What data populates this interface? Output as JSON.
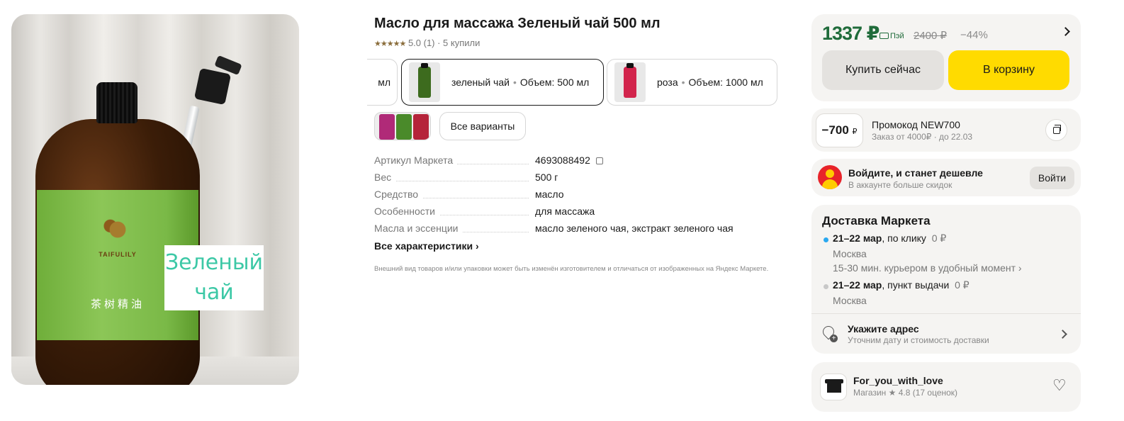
{
  "gallery": {
    "caption": "Зеленый чай",
    "bottle_brand": "TAIFULILY",
    "bottle_label_cn": "茶树精油"
  },
  "product": {
    "title": "Масло для массажа Зеленый чай 500 мл",
    "stars": "★★★★★",
    "rating_text": "5.0 (1) · 5 купили"
  },
  "variants": [
    {
      "label": "мл",
      "color": "#5a7d2c"
    },
    {
      "name": "зеленый чай",
      "volume": "Объем: 500 мл",
      "separator": "•",
      "color": "#3d6b1e"
    },
    {
      "name": "роза",
      "volume": "Объем: 1000 мл",
      "separator": "•",
      "color": "#d2244c"
    }
  ],
  "all_variants_label": "Все варианты",
  "specs": [
    {
      "name": "Артикул Маркета",
      "value": "4693088492"
    },
    {
      "name": "Вес",
      "value": "500 г"
    },
    {
      "name": "Средство",
      "value": "масло"
    },
    {
      "name": "Особенности",
      "value": "для массажа"
    },
    {
      "name": "Масла и эссенции",
      "value": "масло зеленого чая, экстракт зеленого чая"
    }
  ],
  "all_specs_label": "Все характеристики ›",
  "disclaimer": "Внешний вид товаров и/или упаковки может быть изменён изготовителем и отличаться от изображенных на Яндекс Маркете.",
  "price": {
    "current": "1337 ₽",
    "pay_label": "Пэй",
    "old": "2400 ₽",
    "discount": "−44%",
    "buy_now": "Купить сейчас",
    "to_cart": "В корзину",
    "accent": "#1f6b3a",
    "cart_color": "#ffdb00"
  },
  "promo": {
    "amount": "−700",
    "currency": "₽",
    "title": "Промокод NEW700",
    "subtitle": "Заказ от 4000₽ · до 22.03"
  },
  "login": {
    "title": "Войдите, и станет дешевле",
    "subtitle": "В аккаунте больше скидок",
    "button": "Войти"
  },
  "delivery": {
    "title": "Доставка Маркета",
    "options": [
      {
        "date": "21–22 мар",
        "type": ", по клику",
        "price": "0 ₽",
        "city": "Москва",
        "note": "15-30 мин. курьером в удобный момент ›",
        "dot": "#2aa8f0"
      },
      {
        "date": "21–22 мар",
        "type": ", пункт выдачи",
        "price": "0 ₽",
        "city": "Москва",
        "dot": "#c8c8c8"
      }
    ],
    "address_title": "Укажите адрес",
    "address_sub": "Уточним дату и стоимость доставки"
  },
  "shop": {
    "name": "For_you_with_love",
    "meta": "Магазин ★ 4.8 (17 оценок)"
  }
}
